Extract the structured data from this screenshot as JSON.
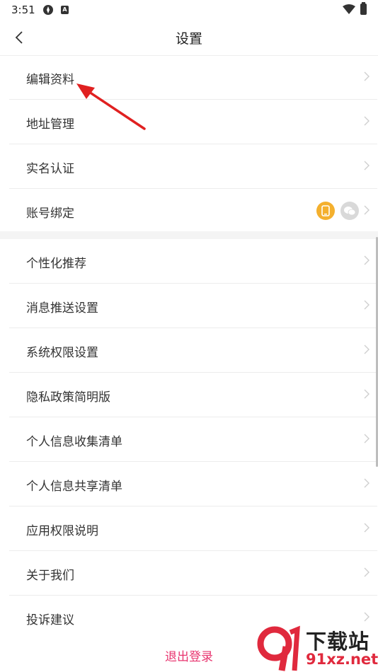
{
  "status_bar": {
    "time": "3:51"
  },
  "header": {
    "title": "设置"
  },
  "group1": [
    {
      "label": "编辑资料"
    },
    {
      "label": "地址管理"
    },
    {
      "label": "实名认证"
    },
    {
      "label": "账号绑定"
    }
  ],
  "group2": [
    {
      "label": "个性化推荐"
    },
    {
      "label": "消息推送设置"
    },
    {
      "label": "系统权限设置"
    },
    {
      "label": "隐私政策简明版"
    },
    {
      "label": "个人信息收集清单"
    },
    {
      "label": "个人信息共享清单"
    },
    {
      "label": "应用权限说明"
    },
    {
      "label": "关于我们"
    },
    {
      "label": "投诉建议"
    }
  ],
  "footer": {
    "logout": "退出登录"
  },
  "watermark": {
    "title": "下载站",
    "url": "91xz.net"
  },
  "colors": {
    "accent": "#e8356f",
    "phone_badge": "#f4b02e",
    "wechat_badge": "#d9d9d9",
    "arrow": "#e02020"
  },
  "icons": {
    "back": "chevron-left-icon",
    "row_arrow": "chevron-right-icon",
    "bound_accounts": [
      "phone-icon",
      "wechat-icon"
    ]
  }
}
